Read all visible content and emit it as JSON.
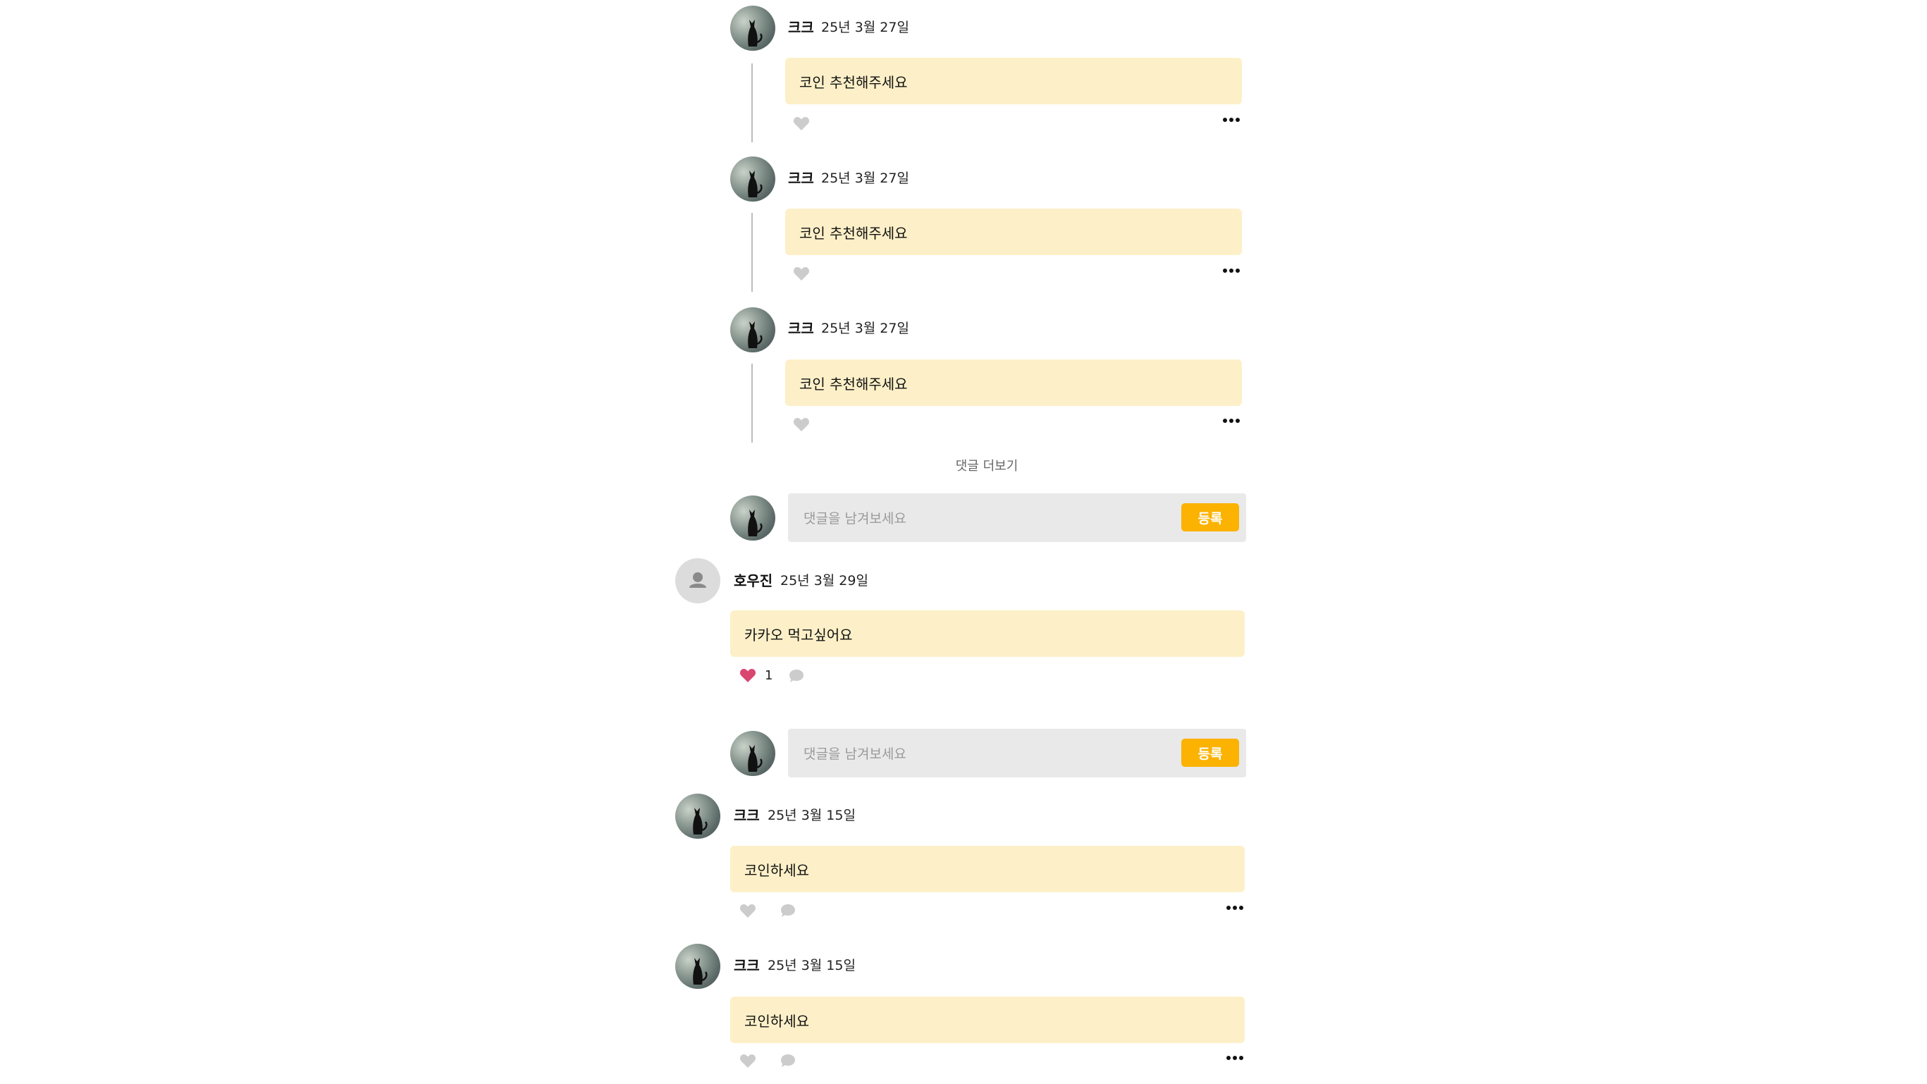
{
  "colors": {
    "bubble": "#fdf0c8",
    "submit_button": "#fbb200",
    "liked_heart": "#d9466f",
    "icon_gray": "#cccccc"
  },
  "replies": [
    {
      "author": "크크",
      "date": "25년 3월 27일",
      "text": "코인 추천해주세요",
      "avatar": "black-cat-avatar",
      "liked": false
    },
    {
      "author": "크크",
      "date": "25년 3월 27일",
      "text": "코인 추천해주세요",
      "avatar": "black-cat-avatar",
      "liked": false
    },
    {
      "author": "크크",
      "date": "25년 3월 27일",
      "text": "코인 추천해주세요",
      "avatar": "black-cat-avatar",
      "liked": false
    }
  ],
  "more_replies_label": "댓글 더보기",
  "reply_input_1": {
    "placeholder": "댓글을 남겨보세요",
    "value": "",
    "submit_label": "등록"
  },
  "comments": [
    {
      "author": "호우진",
      "date": "25년 3월 29일",
      "text": "카카오 먹고싶어요",
      "avatar": "default-user-avatar",
      "liked": true,
      "like_count": "1"
    },
    {
      "author": "크크",
      "date": "25년 3월 15일",
      "text": "코인하세요",
      "avatar": "black-cat-avatar",
      "liked": false
    },
    {
      "author": "크크",
      "date": "25년 3월 15일",
      "text": "코인하세요",
      "avatar": "black-cat-avatar",
      "liked": false
    }
  ],
  "reply_input_2": {
    "placeholder": "댓글을 남겨보세요",
    "value": "",
    "submit_label": "등록"
  }
}
